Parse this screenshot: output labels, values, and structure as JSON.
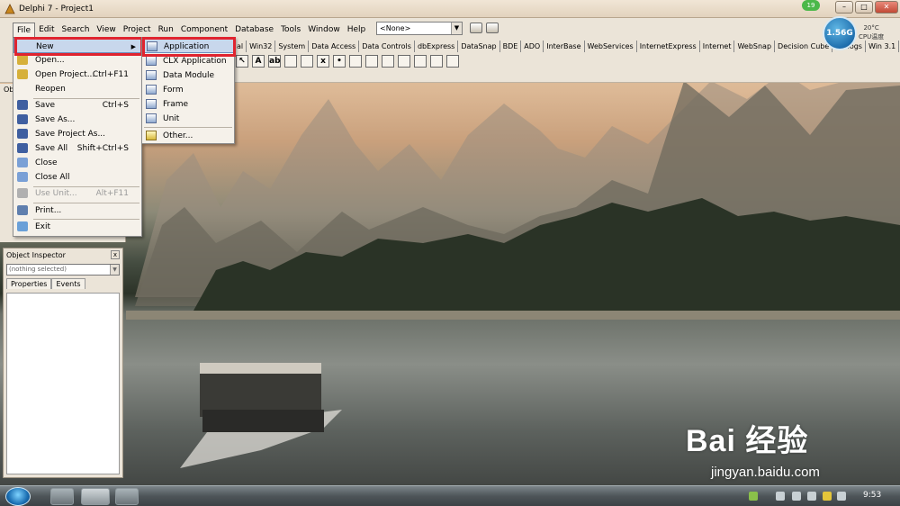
{
  "window": {
    "title": "Delphi 7 - Project1",
    "notification_count": "19"
  },
  "menubar": [
    "File",
    "Edit",
    "Search",
    "View",
    "Project",
    "Run",
    "Component",
    "Database",
    "Tools",
    "Window",
    "Help"
  ],
  "toolbar": {
    "combo_value": "<None>"
  },
  "palette": {
    "tabs": [
      "al",
      "Win32",
      "System",
      "Data Access",
      "Data Controls",
      "dbExpress",
      "DataSnap",
      "BDE",
      "ADO",
      "InterBase",
      "WebServices",
      "InternetExpress",
      "Internet",
      "WebSnap",
      "Decision Cube",
      "Dialogs",
      "Win 3.1"
    ],
    "icons": [
      "A",
      "ab",
      "",
      "",
      "x",
      "•",
      "",
      "",
      "",
      "",
      "",
      "",
      ""
    ]
  },
  "system_monitor": {
    "speed": "1.56G",
    "temperature": "20°C",
    "label": "CPU温度"
  },
  "structure_pane": {
    "title": "Ob"
  },
  "object_inspector": {
    "title": "Object Inspector",
    "selected": "(nothing selected)",
    "tabs": [
      "Properties",
      "Events"
    ]
  },
  "file_menu": {
    "items": [
      {
        "label": "New",
        "shortcut": "",
        "submenu": true,
        "highlight": true,
        "disabled": false,
        "color": "#2f6db5"
      },
      {
        "label": "Open...",
        "shortcut": "",
        "submenu": false,
        "highlight": false,
        "disabled": false,
        "color": "#d6b03a"
      },
      {
        "label": "Open Project...",
        "shortcut": "Ctrl+F11",
        "submenu": false,
        "highlight": false,
        "disabled": false,
        "color": "#d6b03a"
      },
      {
        "label": "Reopen",
        "shortcut": "",
        "submenu": false,
        "highlight": false,
        "disabled": false,
        "color": ""
      },
      {
        "label": "Save",
        "shortcut": "Ctrl+S",
        "submenu": false,
        "highlight": false,
        "disabled": false,
        "color": "#3f5fa0"
      },
      {
        "label": "Save As...",
        "shortcut": "",
        "submenu": false,
        "highlight": false,
        "disabled": false,
        "color": "#3f5fa0"
      },
      {
        "label": "Save Project As...",
        "shortcut": "",
        "submenu": false,
        "highlight": false,
        "disabled": false,
        "color": "#3f5fa0"
      },
      {
        "label": "Save All",
        "shortcut": "Shift+Ctrl+S",
        "submenu": false,
        "highlight": false,
        "disabled": false,
        "color": "#3f5fa0"
      },
      {
        "label": "Close",
        "shortcut": "",
        "submenu": false,
        "highlight": false,
        "disabled": false,
        "color": "#7aa0d6"
      },
      {
        "label": "Close All",
        "shortcut": "",
        "submenu": false,
        "highlight": false,
        "disabled": false,
        "color": "#7aa0d6"
      },
      {
        "label": "Use Unit...",
        "shortcut": "Alt+F11",
        "submenu": false,
        "highlight": false,
        "disabled": true,
        "color": "#b0b0b0"
      },
      {
        "label": "Print...",
        "shortcut": "",
        "submenu": false,
        "highlight": false,
        "disabled": false,
        "color": "#5f7fae"
      },
      {
        "label": "Exit",
        "shortcut": "",
        "submenu": false,
        "highlight": false,
        "disabled": false,
        "color": "#6aa0d8"
      }
    ]
  },
  "new_submenu": {
    "items": [
      {
        "label": "Application",
        "highlight": true
      },
      {
        "label": "CLX Application",
        "highlight": false
      },
      {
        "label": "Data Module",
        "highlight": false
      },
      {
        "label": "Form",
        "highlight": false
      },
      {
        "label": "Frame",
        "highlight": false
      },
      {
        "label": "Unit",
        "highlight": false
      },
      {
        "label": "Other...",
        "highlight": false
      }
    ]
  },
  "watermark": {
    "brand": "Bai 经验",
    "url": "jingyan.baidu.com"
  },
  "taskbar": {
    "time": "9:53"
  }
}
